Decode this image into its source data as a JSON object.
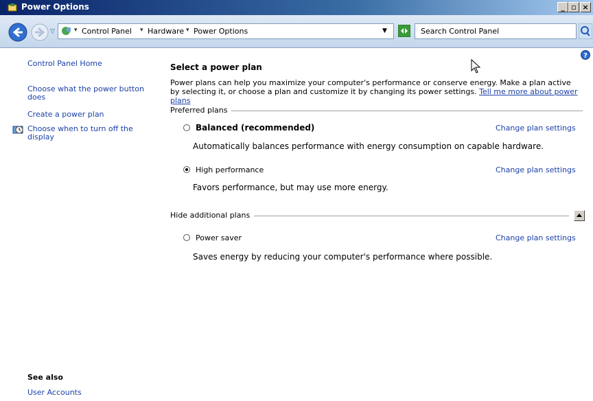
{
  "window": {
    "title": "Power Options"
  },
  "address": {
    "crumbs": [
      "Control Panel",
      "Hardware",
      "Power Options"
    ],
    "search_placeholder": "Search Control Panel"
  },
  "sidebar": {
    "home": "Control Panel Home",
    "links": [
      "Choose what the power button does",
      "Create a power plan",
      "Choose when to turn off the display"
    ],
    "see_also_title": "See also",
    "see_also_link": "User Accounts"
  },
  "main": {
    "heading": "Select a power plan",
    "description": "Power plans can help you maximize your computer's performance or conserve energy. Make a plan active by selecting it, or choose a plan and customize it by changing its power settings.",
    "tell_more_link": "Tell me more about power plans",
    "preferred_label": "Preferred plans",
    "hide_label": "Hide additional plans",
    "change_link": "Change plan settings",
    "plans": [
      {
        "name": "Balanced (recommended)",
        "desc": "Automatically balances performance with energy consumption on capable hardware.",
        "selected": false
      },
      {
        "name": "High performance",
        "desc": "Favors performance, but may use more energy.",
        "selected": true
      },
      {
        "name": "Power saver",
        "desc": "Saves energy by reducing your computer's performance where possible.",
        "selected": false
      }
    ]
  },
  "colors": {
    "link": "#1a3fa8",
    "titlebar": "#0a246a"
  },
  "icons": [
    "power-options-icon",
    "back-arrow-icon",
    "forward-arrow-icon",
    "control-panel-icon",
    "refresh-icon",
    "search-icon",
    "help-icon",
    "monitor-clock-icon",
    "collapse-arrow-icon"
  ]
}
